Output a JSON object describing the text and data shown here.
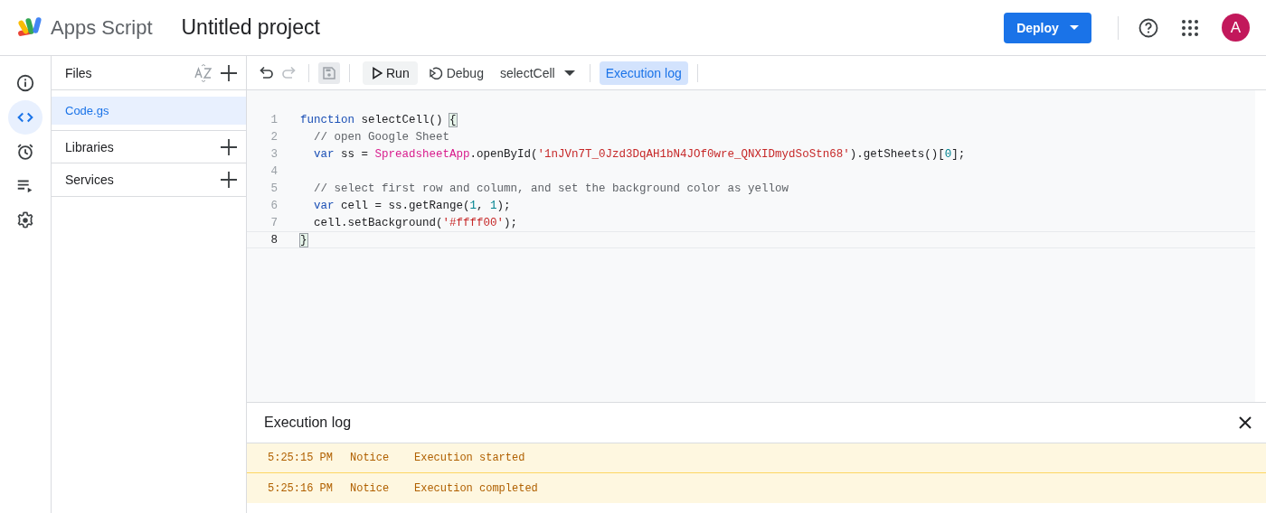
{
  "header": {
    "product": "Apps Script",
    "project_title": "Untitled project",
    "deploy_button": "Deploy",
    "avatar_letter": "A"
  },
  "rail": [
    {
      "selected": false
    },
    {
      "selected": true
    },
    {
      "selected": false
    },
    {
      "selected": false
    },
    {
      "selected": false
    }
  ],
  "files_panel": {
    "title": "Files",
    "files": [
      {
        "name": "Code.gs",
        "selected": true
      }
    ],
    "sections": [
      {
        "label": "Libraries"
      },
      {
        "label": "Services"
      }
    ]
  },
  "toolbar": {
    "run": "Run",
    "debug": "Debug",
    "function_select": "selectCell",
    "execution_log": {
      "label": "Execution log",
      "on": true
    },
    "save_disabled": true
  },
  "editor": {
    "lines": [
      {
        "number": "1",
        "current": false,
        "tokens": [
          {
            "kind": "kw",
            "text": "function"
          },
          {
            "kind": "plain",
            "text": " selectCell() "
          },
          {
            "kind": "brace",
            "text": "{"
          }
        ]
      },
      {
        "number": "2",
        "current": false,
        "tokens": [
          {
            "kind": "comment",
            "text": "  // open Google Sheet"
          }
        ]
      },
      {
        "number": "3",
        "current": false,
        "tokens": [
          {
            "kind": "kw",
            "text": "  var"
          },
          {
            "kind": "plain",
            "text": " ss = "
          },
          {
            "kind": "cls",
            "text": "SpreadsheetApp"
          },
          {
            "kind": "plain",
            "text": ".openById("
          },
          {
            "kind": "str",
            "text": "'1nJVn7T_0Jzd3DqAH1bN4JOf0wre_QNXIDmydSoStn68'"
          },
          {
            "kind": "plain",
            "text": ").getSheets()["
          },
          {
            "kind": "num",
            "text": "0"
          },
          {
            "kind": "plain",
            "text": "];"
          }
        ]
      },
      {
        "number": "4",
        "current": false
      },
      {
        "number": "5",
        "current": false,
        "tokens": [
          {
            "kind": "comment",
            "text": "  // select first row and column, and set the background color as yellow"
          }
        ]
      },
      {
        "number": "6",
        "current": false,
        "tokens": [
          {
            "kind": "kw",
            "text": "  var"
          },
          {
            "kind": "plain",
            "text": " cell = ss.getRange("
          },
          {
            "kind": "num",
            "text": "1"
          },
          {
            "kind": "plain",
            "text": ", "
          },
          {
            "kind": "num",
            "text": "1"
          },
          {
            "kind": "plain",
            "text": ");"
          }
        ]
      },
      {
        "number": "7",
        "current": false,
        "tokens": [
          {
            "kind": "plain",
            "text": "  cell.setBackground("
          },
          {
            "kind": "str",
            "text": "'#ffff00'"
          },
          {
            "kind": "plain",
            "text": ");"
          }
        ]
      },
      {
        "number": "8",
        "current": true,
        "tokens": [
          {
            "kind": "brace",
            "text": "}"
          }
        ]
      }
    ]
  },
  "execution_log": {
    "title": "Execution log",
    "rows": [
      {
        "time": "5:25:15 PM",
        "level": "Notice",
        "message": "Execution started"
      },
      {
        "time": "5:25:16 PM",
        "level": "Notice",
        "message": "Execution completed"
      }
    ]
  }
}
